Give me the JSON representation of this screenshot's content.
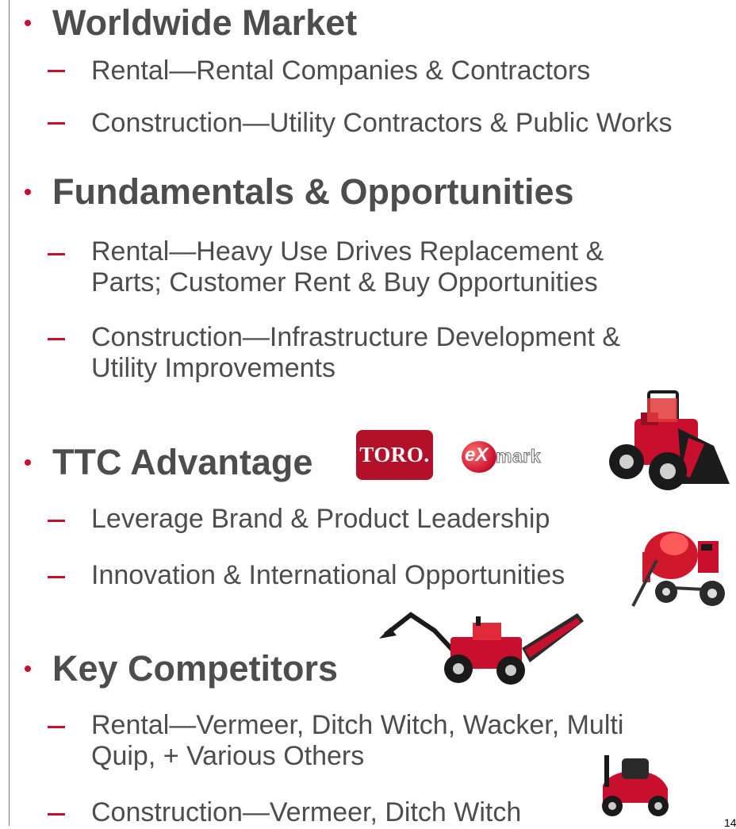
{
  "sections": [
    {
      "heading": "Worldwide Market",
      "items": [
        "Rental—Rental Companies & Contractors",
        "Construction—Utility Contractors & Public Works"
      ]
    },
    {
      "heading": "Fundamentals & Opportunities",
      "items": [
        [
          "Rental—Heavy Use Drives Replacement &",
          "Parts; Customer Rent & Buy Opportunities"
        ],
        [
          "Construction—Infrastructure Development &",
          "Utility Improvements"
        ]
      ]
    },
    {
      "heading": "TTC Advantage",
      "items": [
        "Leverage Brand & Product Leadership",
        "Innovation & International Opportunities"
      ]
    },
    {
      "heading": "Key Competitors",
      "items": [
        [
          "Rental—Vermeer, Ditch Witch, Wacker, Multi",
          "Quip, + Various Others"
        ],
        "Construction—Vermeer, Ditch Witch"
      ]
    }
  ],
  "logos": {
    "toro": "TORO.",
    "exmark_ball": "eX",
    "exmark_text": "mark"
  },
  "page_number": "14",
  "colors": {
    "accent": "#c8102e",
    "text": "#4d4d4d"
  },
  "images": [
    "compact-loader-icon",
    "cement-mixer-icon",
    "trencher-backhoe-icon",
    "lawn-mower-icon"
  ]
}
